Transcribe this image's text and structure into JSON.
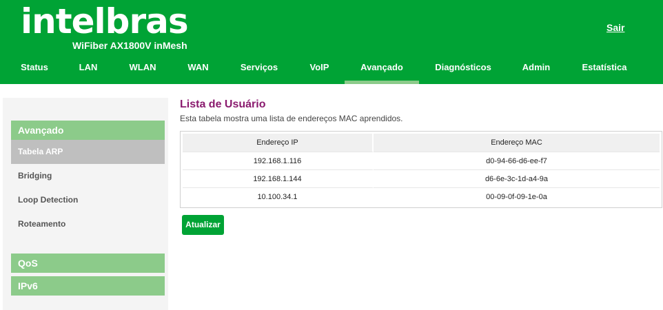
{
  "header": {
    "logo": "intelbras",
    "model": "WiFiber AX1800V inMesh",
    "logout_label": "Sair",
    "color": "#00a335"
  },
  "nav": {
    "items": [
      {
        "label": "Status"
      },
      {
        "label": "LAN"
      },
      {
        "label": "WLAN"
      },
      {
        "label": "WAN"
      },
      {
        "label": "Serviços"
      },
      {
        "label": "VoIP"
      },
      {
        "label": "Avançado",
        "active": true
      },
      {
        "label": "Diagnósticos"
      },
      {
        "label": "Admin"
      },
      {
        "label": "Estatística"
      }
    ]
  },
  "sidebar": {
    "sections": [
      {
        "label": "Avançado"
      },
      {
        "label": "QoS"
      },
      {
        "label": "IPv6"
      }
    ],
    "items": [
      {
        "label": "Tabela ARP",
        "active": true
      },
      {
        "label": "Bridging"
      },
      {
        "label": "Loop Detection"
      },
      {
        "label": "Roteamento"
      }
    ]
  },
  "main": {
    "title": "Lista de Usuário",
    "description": "Esta tabela mostra uma lista de endereços MAC aprendidos.",
    "table": {
      "headers": [
        "Endereço IP",
        "Endereço MAC"
      ],
      "rows": [
        [
          "192.168.1.116",
          "d0-94-66-d6-ee-f7"
        ],
        [
          "192.168.1.144",
          "d6-6e-3c-1d-a4-9a"
        ],
        [
          "10.100.34.1",
          "00-09-0f-09-1e-0a"
        ]
      ]
    },
    "refresh_label": "Atualizar"
  }
}
